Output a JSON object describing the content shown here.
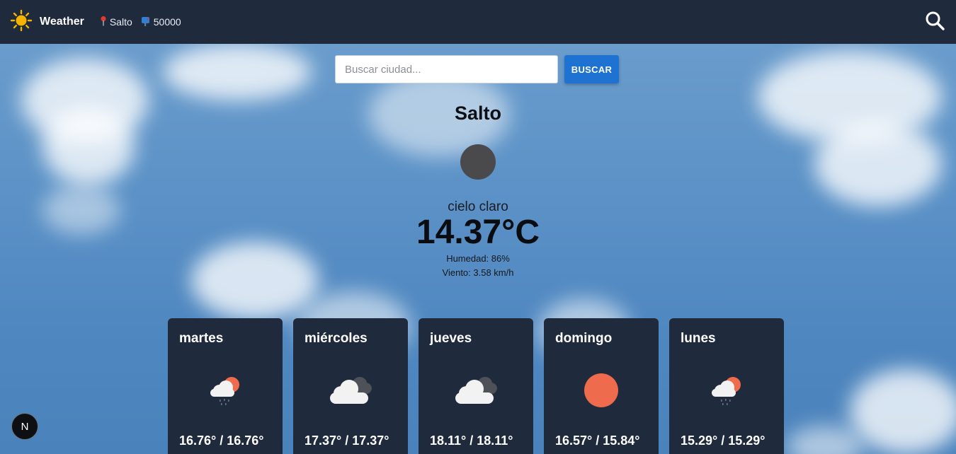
{
  "nav": {
    "brand_title": "Weather",
    "city": "Salto",
    "postal": "50000",
    "sun_color": "#f5b400",
    "pin_icon": "pin-icon",
    "mailbox_icon": "mailbox-icon"
  },
  "search": {
    "placeholder": "Buscar ciudad...",
    "value": "",
    "button_label": "BUSCAR"
  },
  "current": {
    "city": "Salto",
    "condition": "cielo claro",
    "temperature": "14.37°C",
    "humidity": "Humedad: 86%",
    "wind": "Viento: 3.58 km/h"
  },
  "forecast": [
    {
      "day": "martes",
      "temps": "16.76° / 16.76°",
      "icon": "rain-sun-cloud-icon"
    },
    {
      "day": "miércoles",
      "temps": "17.37° / 17.37°",
      "icon": "dark-clouds-icon"
    },
    {
      "day": "jueves",
      "temps": "18.11° / 18.11°",
      "icon": "dark-clouds-icon"
    },
    {
      "day": "domingo",
      "temps": "16.57° / 15.84°",
      "icon": "sun-icon"
    },
    {
      "day": "lunes",
      "temps": "15.29° / 15.29°",
      "icon": "rain-sun-cloud-icon"
    }
  ],
  "badge": {
    "label": "N"
  },
  "colors": {
    "navbar": "#1f2a3c",
    "card": "#1f2a3c",
    "button": "#1e73d2",
    "sun_orange": "#ee6b4d"
  }
}
